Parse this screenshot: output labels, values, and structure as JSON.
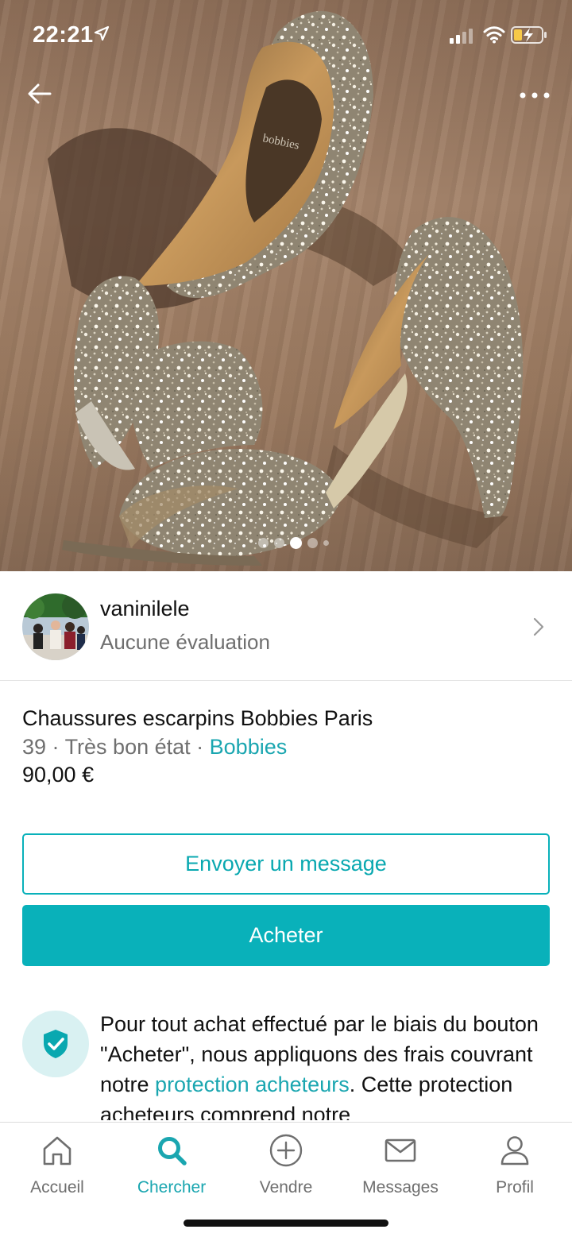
{
  "status_bar": {
    "time": "22:21"
  },
  "gallery": {
    "page_count": 5,
    "active_index": 2
  },
  "seller": {
    "username": "vaninilele",
    "rating": "Aucune évaluation"
  },
  "item": {
    "title": "Chaussures escarpins Bobbies Paris",
    "size": "39",
    "separator": " · ",
    "condition": "Très bon état",
    "brand": "Bobbies",
    "price": "90,00 €",
    "photo_logo_text": "bobbies"
  },
  "actions": {
    "message_label": "Envoyer un message",
    "buy_label": "Acheter"
  },
  "protection": {
    "text_before": "Pour tout achat effectué par le biais du bouton \"Acheter\", nous appliquons des frais couvrant notre ",
    "link_text": "protection acheteurs",
    "text_after": ". Cette protection acheteurs comprend notre"
  },
  "tabbar": {
    "items": [
      {
        "label": "Accueil",
        "icon": "home-icon"
      },
      {
        "label": "Chercher",
        "icon": "search-icon"
      },
      {
        "label": "Vendre",
        "icon": "plus-circle-icon"
      },
      {
        "label": "Messages",
        "icon": "mail-icon"
      },
      {
        "label": "Profil",
        "icon": "user-icon"
      }
    ],
    "active_index": 1
  },
  "colors": {
    "accent": "#09b1ba",
    "link": "#1aa6b0",
    "muted_text": "#6f6f6f"
  }
}
